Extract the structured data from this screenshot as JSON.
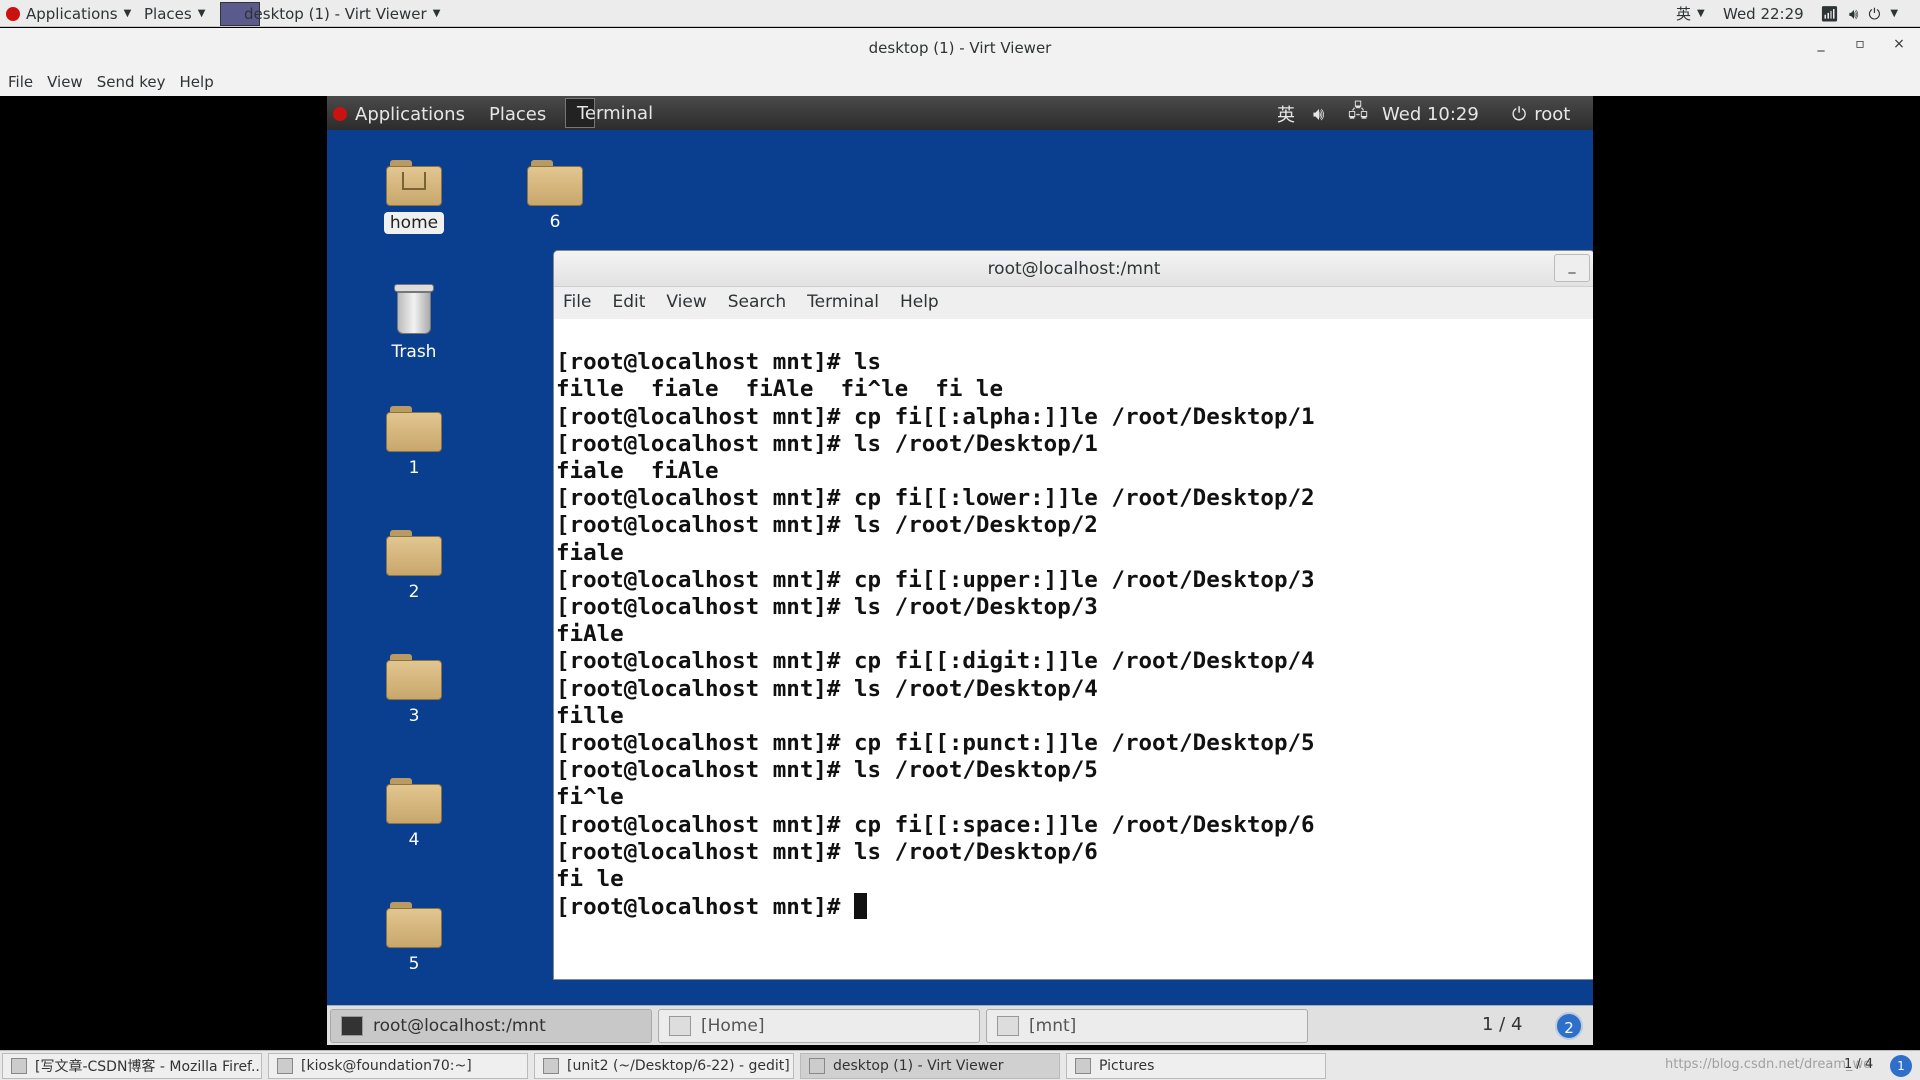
{
  "host_top_panel": {
    "applications": "Applications",
    "places": "Places",
    "window": "desktop (1) - Virt Viewer",
    "input_method": "英",
    "clock": "Wed 22:29"
  },
  "virt_viewer": {
    "title": "desktop (1) - Virt Viewer",
    "menu": [
      "File",
      "View",
      "Send key",
      "Help"
    ],
    "controls": {
      "minimize": "_",
      "maximize": "▫",
      "close": "×"
    }
  },
  "guest_top_panel": {
    "applications": "Applications",
    "places": "Places",
    "terminal": "Terminal",
    "input_method": "英",
    "clock": "Wed 10:29",
    "user": "root"
  },
  "desktop_icons": [
    {
      "label": "home",
      "type": "home"
    },
    {
      "label": "6",
      "type": "folder"
    },
    {
      "label": "Trash",
      "type": "trash"
    },
    {
      "label": "1",
      "type": "folder"
    },
    {
      "label": "2",
      "type": "folder"
    },
    {
      "label": "3",
      "type": "folder"
    },
    {
      "label": "4",
      "type": "folder"
    },
    {
      "label": "5",
      "type": "folder"
    }
  ],
  "terminal": {
    "title": "root@localhost:/mnt",
    "minimize": "_",
    "menu": [
      "File",
      "Edit",
      "View",
      "Search",
      "Terminal",
      "Help"
    ],
    "lines": [
      "[root@localhost mnt]# ls",
      "fille  fiale  fiAle  fi^le  fi le",
      "[root@localhost mnt]# cp fi[[:alpha:]]le /root/Desktop/1",
      "[root@localhost mnt]# ls /root/Desktop/1",
      "fiale  fiAle",
      "[root@localhost mnt]# cp fi[[:lower:]]le /root/Desktop/2",
      "[root@localhost mnt]# ls /root/Desktop/2",
      "fiale",
      "[root@localhost mnt]# cp fi[[:upper:]]le /root/Desktop/3",
      "[root@localhost mnt]# ls /root/Desktop/3",
      "fiAle",
      "[root@localhost mnt]# cp fi[[:digit:]]le /root/Desktop/4",
      "[root@localhost mnt]# ls /root/Desktop/4",
      "fille",
      "[root@localhost mnt]# cp fi[[:punct:]]le /root/Desktop/5",
      "[root@localhost mnt]# ls /root/Desktop/5",
      "fi^le",
      "[root@localhost mnt]# cp fi[[:space:]]le /root/Desktop/6",
      "[root@localhost mnt]# ls /root/Desktop/6",
      "fi le"
    ],
    "prompt": "[root@localhost mnt]# "
  },
  "guest_taskbar": {
    "tasks": [
      "root@localhost:/mnt",
      "[Home]",
      "[mnt]"
    ],
    "workspace": "1 / 4",
    "workspace_badge": "2"
  },
  "host_taskbar": {
    "tasks": [
      "[写文章-CSDN博客 - Mozilla Firef...",
      "[kiosk@foundation70:~]",
      "[unit2 (~/Desktop/6-22) - gedit]",
      "desktop (1) - Virt Viewer",
      "Pictures"
    ],
    "watermark": "https://blog.csdn.net/dream_wo",
    "workspace": "1 / 4",
    "workspace_badge": "1"
  }
}
